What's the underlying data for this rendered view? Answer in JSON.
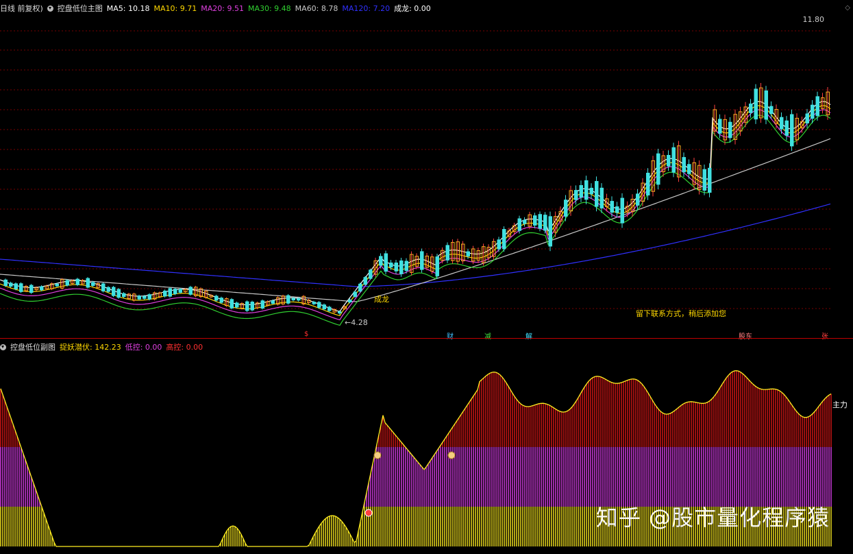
{
  "main_header": {
    "period": "日线 前复权)",
    "indicator_name": "控盘低位主图",
    "ma": [
      {
        "label": "MA5: 10.18",
        "color": "#ffffff"
      },
      {
        "label": "MA10: 9.71",
        "color": "#ffd800"
      },
      {
        "label": "MA20: 9.51",
        "color": "#e040e0"
      },
      {
        "label": "MA30: 9.48",
        "color": "#30d030"
      },
      {
        "label": "MA60: 8.78",
        "color": "#c8c8c8"
      },
      {
        "label": "MA120: 7.20",
        "color": "#3030ff"
      },
      {
        "label": "成龙: 0.00",
        "color": "#ffffff"
      }
    ]
  },
  "main_chart": {
    "price_max_label": "11.80",
    "price_min_label": "←4.28",
    "signal_label": "成龙",
    "note_text": "留下联系方式，稍后添加您",
    "bottom_markers": [
      {
        "text": "$",
        "color": "#ff3030"
      },
      {
        "text": "财",
        "color": "#40c0ff"
      },
      {
        "text": "减",
        "color": "#40e040"
      },
      {
        "text": "解",
        "color": "#40e0ff"
      },
      {
        "text": "股东",
        "color": "#ff8080"
      },
      {
        "text": "张",
        "color": "#ff4040"
      }
    ]
  },
  "sub_header": {
    "indicator_name": "控盘低位副图",
    "values": [
      {
        "label": "捉妖潜伏: 142.23",
        "color": "#ffd800"
      },
      {
        "label": "低控: 0.00",
        "color": "#e040e0"
      },
      {
        "label": "高控: 0.00",
        "color": "#ff3030"
      }
    ]
  },
  "sub_chart": {
    "right_label": "主力"
  },
  "colors": {
    "up_candle": "#ffb020",
    "down_candle": "#40e0e0",
    "grid": "#7a0000",
    "yellow_bar": "#ffee20",
    "magenta_bar": "#e040f0",
    "red_bar": "#e01818"
  },
  "watermark": "知乎 @股市量化程序猿"
}
